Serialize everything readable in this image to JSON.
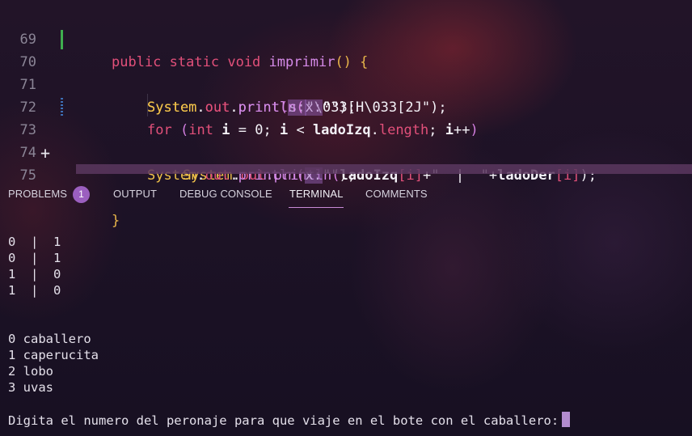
{
  "editor": {
    "lines": [
      {
        "num": "69"
      },
      {
        "num": "70"
      },
      {
        "num": "71"
      },
      {
        "num": "72"
      },
      {
        "num": "73"
      },
      {
        "num": "74"
      },
      {
        "num": "75"
      }
    ],
    "line69": {
      "kw1": "public",
      "kw2": "static",
      "kw3": "void",
      "fn": "imprimir",
      "paren": "()",
      "brace": "{"
    },
    "line70": {
      "cls": "System",
      "fld": "out",
      "fn": "print",
      "hint": "s:",
      "str": "\"\\033[H\\033[2J\"",
      "end": ");"
    },
    "line71": {
      "cls": "System",
      "fld": "out",
      "fn": "println",
      "hint": "x:",
      "str": "\"\"",
      "end": ");"
    },
    "line72": {
      "kw": "for",
      "ty": "int",
      "v1": "i",
      "eq": "=",
      "zero": "0",
      "v2": "i",
      "lt": "<",
      "arr": "ladoIzq",
      "len": "length",
      "v3": "i",
      "inc": "++"
    },
    "line73": {
      "cls": "System",
      "fld": "out",
      "fn": "println",
      "arr1": "ladoIzq",
      "idx1": "i",
      "plus1": "+",
      "str": "\"  |  \"",
      "plus2": "+",
      "arr2": "ladoDer",
      "idx2": "i",
      "end": ");"
    },
    "line74": {
      "cls": "System",
      "fld": "out",
      "fn": "println",
      "hint": "x:",
      "str": "\"\"",
      "end": ");"
    },
    "line75": {
      "brace": "}",
      "add_glyph": "+"
    }
  },
  "panel": {
    "tabs": [
      {
        "label": "PROBLEMS",
        "badge": "1"
      },
      {
        "label": "OUTPUT"
      },
      {
        "label": "DEBUG CONSOLE"
      },
      {
        "label": "TERMINAL",
        "active": true
      },
      {
        "label": "COMMENTS"
      }
    ]
  },
  "terminal": {
    "lines": [
      "0  |  1",
      "0  |  1",
      "1  |  0",
      "1  |  0",
      "0 caballero",
      "1 caperucita",
      "2 lobo",
      "3 uvas",
      "Digita el numero del peronaje para que viaje en el bote con el caballero:"
    ]
  }
}
